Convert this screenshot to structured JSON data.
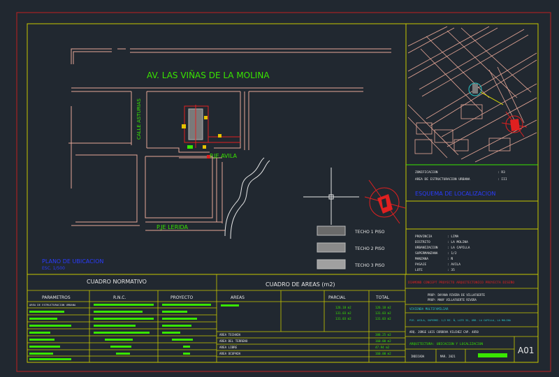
{
  "colors": {
    "background": "#212830",
    "frame": "#c8c800",
    "outer_border": "#c02020",
    "street": "#e8a898",
    "text_green": "#39e600",
    "text_yellow": "#e6e600",
    "text_blue": "#2a3cff",
    "text_cyan": "#29c6c6",
    "text_white": "#e8e8e8",
    "north_red": "#e02020"
  },
  "site_plan": {
    "avenue_label": "AV. LAS VIÑAS DE LA MOLINA",
    "street_left": "CALLE ASTURIAS",
    "street_avila": "P.JE AVILA",
    "street_lerida": "P.JE LERIDA",
    "plan_title": "PLANO DE UBICACION",
    "plan_scale": "ESC. 1/500"
  },
  "legend": [
    {
      "label": "TECHO 1 PISO"
    },
    {
      "label": "TECHO 2 PISO"
    },
    {
      "label": "TECHO 3 PISO"
    }
  ],
  "location_panel": {
    "lines": [
      {
        "label": "ZONIFICACION",
        "value": ": R3"
      },
      {
        "label": "AREA DE ESTRUCTURACION URBANA",
        "value": ": III"
      }
    ],
    "title": "ESQUEMA DE LOCALIZACION"
  },
  "data_panel": [
    {
      "label": "PROVINCIA",
      "value": ": LIMA"
    },
    {
      "label": "DISTRITO",
      "value": ": LA MOLINA"
    },
    {
      "label": "URBANIZACION",
      "value": ": LA CAPILLA"
    },
    {
      "label": "SUPERMANZANA",
      "value": ": 1/2"
    },
    {
      "label": "MANZANA",
      "value": ": Ñ"
    },
    {
      "label": "PASAJE",
      "value": ": AVILA"
    },
    {
      "label": "LOTE",
      "value": ": 35"
    }
  ],
  "cuadro_normativo": {
    "title": "CUADRO NORMATIVO",
    "headers": [
      "PARAMETROS",
      "R.N.C.",
      "PROYECTO"
    ],
    "first_row": "AREA DE ESTRUCTURACION URBANA"
  },
  "cuadro_areas": {
    "title": "CUADRO DE AREAS (m2)",
    "headers": [
      "AREAS",
      "PARCIAL",
      "TOTAL"
    ],
    "rows": [
      {
        "parcial": "126.18 m2",
        "total": "126.18 m2"
      },
      {
        "parcial": "131.03 m2",
        "total": "131.03 m2"
      },
      {
        "parcial": "131.03 m2",
        "total": "131.03 m2"
      }
    ],
    "summary": [
      {
        "label": "AREA TECHADA",
        "value": "388.25 m2"
      },
      {
        "label": "AREA DEL TERRENO",
        "value": "160.00 m2"
      },
      {
        "label": "AREA LIBRE",
        "value": "47.94 m2"
      },
      {
        "label": "AREA OCUPADA",
        "value": "160.00 m2"
      }
    ]
  },
  "title_block": {
    "header": "DIAMOND CONCEPT PROYECTO ARQUITECTONICO PROYECTA DISEÑO",
    "owners": [
      "PROP: DAYANA RIVERA DE VILLAFUERTE",
      "PROP: MANY VILLAFUERTE RIVERA"
    ],
    "project_type": "VIVIENDA MULTIFAMILIAR",
    "address": "PJE. AVILA, SUPERMZ. 1/2 MZ. Ñ, LOTE 35, URB. LA CAPILLA, LA MOLINA",
    "architect": "ARQ. JORGE LUIS CORDOVA VILCHEZ CAP. 4850",
    "drawing_title": "ARQUITECTURA: UBICACION Y LOCALIZACION",
    "scale": "INDICADA",
    "date": "MAR. 2021",
    "sheet": "A01"
  }
}
